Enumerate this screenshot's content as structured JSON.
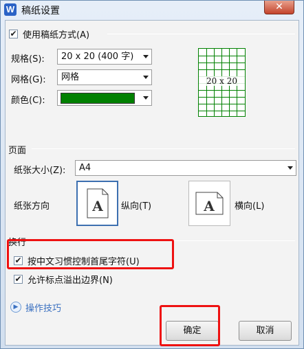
{
  "window": {
    "app_icon_letter": "W",
    "title": "稿纸设置",
    "close_glyph": "✕"
  },
  "draft": {
    "enable_checked": true,
    "enable_label": "使用稿纸方式(A)",
    "spec_label": "规格(S):",
    "spec_value": "20 x 20 (400 字)",
    "grid_label": "网格(G):",
    "grid_value": "网格",
    "color_label": "颜色(C):",
    "color_value": "#008000",
    "preview_text": "20 x 20"
  },
  "page": {
    "section_label": "页面",
    "paper_size_label": "纸张大小(Z):",
    "paper_size_value": "A4",
    "orientation_label": "纸张方向",
    "portrait_label": "纵向(T)",
    "landscape_label": "横向(L)",
    "orientation_selected": "portrait"
  },
  "wrap": {
    "section_label": "换行",
    "option1_checked": true,
    "option1_label": "按中文习惯控制首尾字符(U)",
    "option2_checked": true,
    "option2_label": "允许标点溢出边界(N)"
  },
  "footer": {
    "tips_link": "操作技巧",
    "ok_label": "确定",
    "cancel_label": "取消"
  },
  "colors": {
    "highlight": "#ee1111",
    "grid": "#008000",
    "link": "#3a70c0"
  }
}
